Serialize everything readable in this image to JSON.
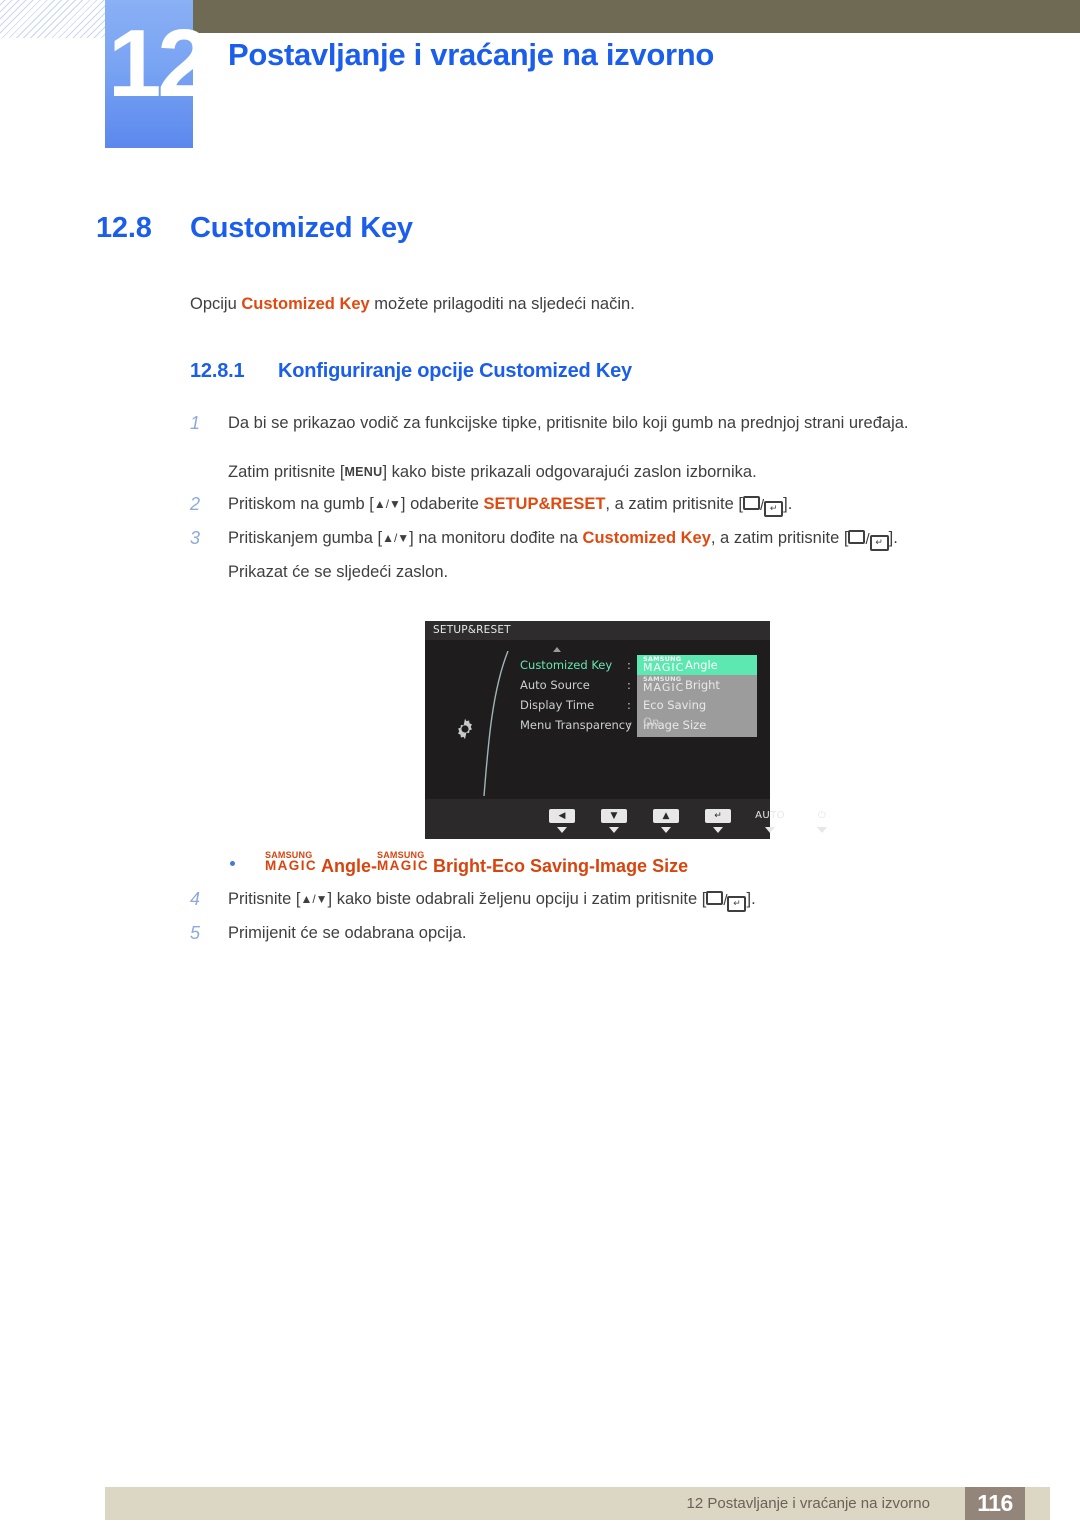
{
  "header": {
    "chapter_number": "12",
    "chapter_title": "Postavljanje i vraćanje na izvorno"
  },
  "section": {
    "number": "12.8",
    "title": "Customized Key",
    "intro_before": "Opciju ",
    "intro_highlight": "Customized Key",
    "intro_after": " možete prilagoditi na sljedeći način."
  },
  "subsection": {
    "number": "12.8.1",
    "title": "Konfiguriranje opcije Customized Key"
  },
  "steps": {
    "step1_num": "1",
    "step1_text": "Da bi se prikazao vodič za funkcijske tipke, pritisnite bilo koji gumb na prednjoj strani uređaja.",
    "step1_sub_before": "Zatim pritisnite [",
    "step1_sub_key": "MENU",
    "step1_sub_after": "] kako biste prikazali odgovarajući zaslon izbornika.",
    "step2_num": "2",
    "step2_a": "Pritiskom na gumb [",
    "step2_arrows": "▲/▼",
    "step2_b": "] odaberite ",
    "step2_hl": "SETUP&RESET",
    "step2_c": ", a zatim pritisnite [",
    "step2_d": "].",
    "step3_num": "3",
    "step3_a": "Pritiskanjem gumba [",
    "step3_arrows": "▲/▼",
    "step3_b": "] na monitoru dođite na ",
    "step3_hl": "Customized Key",
    "step3_c": ", a zatim pritisnite [",
    "step3_d": "].",
    "step3_sub": "Prikazat će se sljedeći zaslon.",
    "step4_num": "4",
    "step4_a": "Pritisnite [",
    "step4_arrows": "▲/▼",
    "step4_b": "] kako biste odabrali željenu opciju i zatim pritisnite [",
    "step4_c": "].",
    "step5_num": "5",
    "step5_text": "Primijenit će se odabrana opcija."
  },
  "osd": {
    "title": "SETUP&RESET",
    "menu_items": [
      {
        "label": "Customized Key",
        "selected": true
      },
      {
        "label": "Auto Source",
        "selected": false
      },
      {
        "label": "Display Time",
        "selected": false
      },
      {
        "label": "Menu Transparency",
        "selected": false
      }
    ],
    "colon": ":",
    "menu_transparency_value": "On",
    "popup": {
      "samsung": "SAMSUNG",
      "magic": "MAGIC",
      "rows": [
        {
          "prefix": "magic",
          "label": "Angle",
          "selected": true
        },
        {
          "prefix": "magic",
          "label": "Bright",
          "selected": false
        },
        {
          "prefix": "",
          "label": "Eco Saving",
          "selected": false
        },
        {
          "prefix": "",
          "label": "Image Size",
          "selected": false
        }
      ]
    },
    "buttons": [
      {
        "type": "cap",
        "glyph": "◀",
        "name": "left-arrow"
      },
      {
        "type": "cap",
        "glyph": "▼",
        "name": "down-arrow"
      },
      {
        "type": "cap",
        "glyph": "▲",
        "name": "up-arrow"
      },
      {
        "type": "cap",
        "glyph": "↵",
        "name": "enter"
      },
      {
        "type": "txt",
        "glyph": "AUTO",
        "name": "auto"
      },
      {
        "type": "txt",
        "glyph": "⏻",
        "name": "power"
      }
    ]
  },
  "bullet_note": {
    "samsung": "SAMSUNG",
    "magic": "MAGIC",
    "angle": "Angle",
    "sep1": " - ",
    "bright": "Bright",
    "sep2": " - ",
    "eco": "Eco Saving",
    "sep3": " - ",
    "imagesize": "Image Size"
  },
  "footer": {
    "text": "12 Postavljanje i vraćanje na izvorno",
    "page_number": "116"
  },
  "colors": {
    "accent_blue": "#1b5eeb",
    "highlight_orange": "#e04a10",
    "olive": "#6e6a53",
    "footer_beige": "#dcd6c4",
    "osd_green": "#5ee8b1"
  }
}
